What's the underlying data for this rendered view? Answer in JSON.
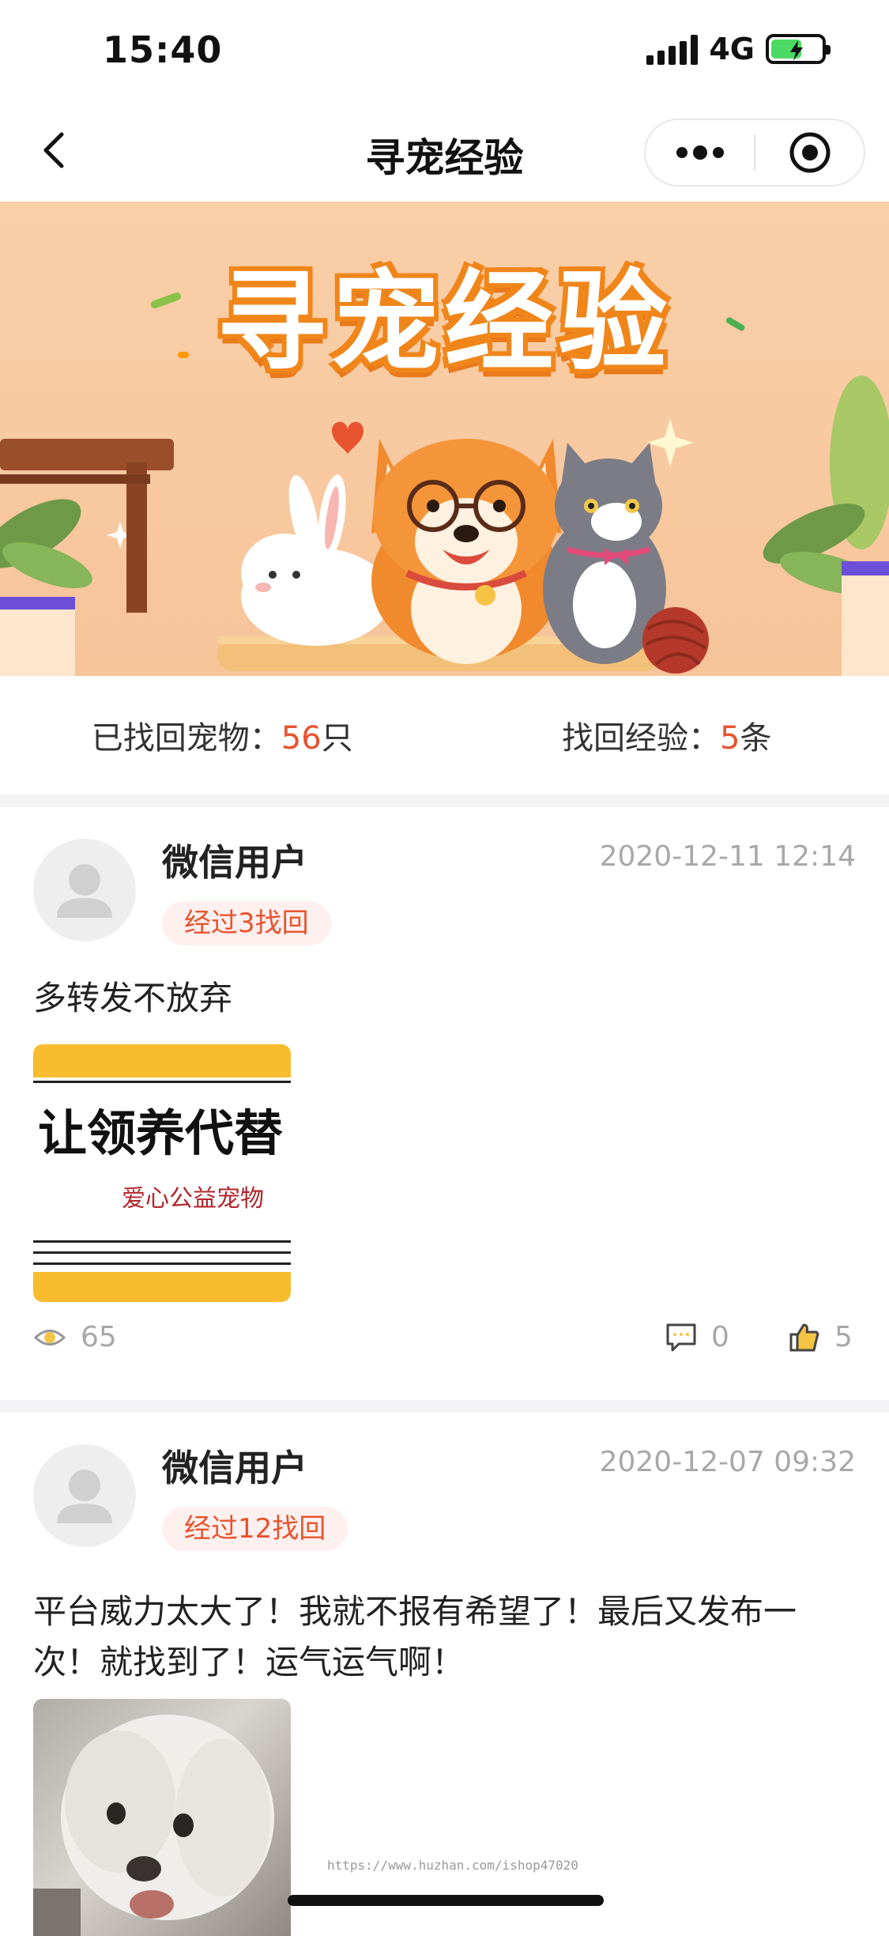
{
  "status_bar": {
    "time": "15:40",
    "network": "4G"
  },
  "nav": {
    "title": "寻宠经验"
  },
  "banner": {
    "title": "寻宠经验"
  },
  "stats": {
    "found_label": "已找回宠物：",
    "found_count": "56",
    "found_unit": "只",
    "exp_label": "找回经验：",
    "exp_count": "5",
    "exp_unit": "条"
  },
  "posts": [
    {
      "user": "微信用户",
      "time": "2020-12-11 12:14",
      "tag": "经过3找回",
      "text": "多转发不放弃",
      "image": {
        "line1": "让领养代替",
        "line2": "爱心公益宠物"
      },
      "views": "65",
      "comments": "0",
      "likes": "5"
    },
    {
      "user": "微信用户",
      "time": "2020-12-07 09:32",
      "tag": "经过12找回",
      "text": "平台威力太大了！我就不报有希望了！最后又发布一次！就找到了！运气运气啊！"
    }
  ],
  "watermark": "https://www.huzhan.com/ishop47020",
  "colors": {
    "accent": "#e8532f",
    "banner_bg": "#f9cfa8",
    "tag_bg": "#fdf0ee",
    "muted": "#a8a8a8"
  },
  "icons": [
    "back-arrow-icon",
    "more-dots-icon",
    "target-close-icon",
    "eye-icon",
    "comment-icon",
    "thumb-up-icon",
    "avatar-placeholder-icon"
  ]
}
